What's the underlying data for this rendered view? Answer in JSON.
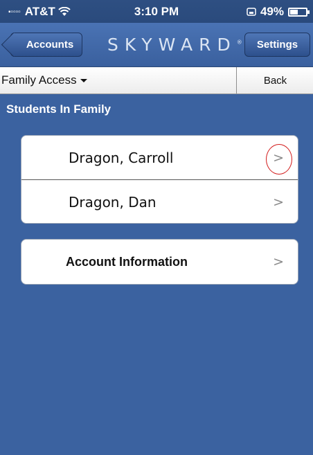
{
  "status_bar": {
    "carrier": "AT&T",
    "signal_icon": "signal-dots-icon",
    "wifi_icon": "wifi-icon",
    "time": "3:10 PM",
    "sync_icon": "sync-icon",
    "battery_percent": "49%",
    "battery_level": 0.49
  },
  "nav_bar": {
    "back_label": "Accounts",
    "brand": "SKYWARD",
    "brand_mark": "®",
    "settings_label": "Settings"
  },
  "sub_bar": {
    "menu_label": "Family Access",
    "menu_icon": "caret-down-icon",
    "back_label": "Back"
  },
  "section": {
    "title": "Students In Family"
  },
  "students": [
    {
      "name": "Dragon,  Carroll",
      "chevron": ">"
    },
    {
      "name": "Dragon,  Dan",
      "chevron": ">"
    }
  ],
  "account_info": {
    "label": "Account Information",
    "chevron": ">"
  },
  "colors": {
    "background": "#3b62a0",
    "nav": "#4a73b4",
    "highlight": "#d21a1a"
  }
}
